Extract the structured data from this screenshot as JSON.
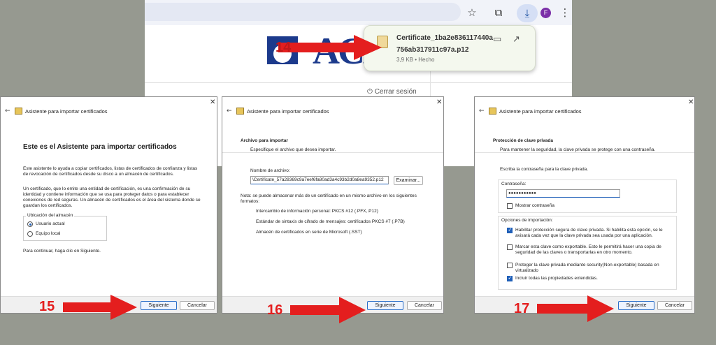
{
  "browser": {
    "icons": [
      "star-icon",
      "extensions-icon",
      "download-icon",
      "profile-avatar",
      "more-menu-icon"
    ],
    "avatar_letter": "F",
    "logout": "⏻ Cerrar sesión",
    "download": {
      "filename_line1": "Certificate_1ba2e836117440a",
      "filename_line2": "756ab317911c97a.p12",
      "meta": "3,9 KB • Hecho"
    }
  },
  "step_numbers": {
    "s14": "14",
    "s15": "15",
    "s16": "16",
    "s17": "17"
  },
  "wizard_title": "Asistente para importar certificados",
  "dialog1": {
    "heading": "Este es el Asistente para importar certificados",
    "p1": "Este asistente lo ayuda a copiar certificados, listas de certificados de confianza y listas de revocación de certificados desde su disco a un almacén de certificados.",
    "p2": "Un certificado, que lo emite una entidad de certificación, es una confirmación de su identidad y contiene información que se usa para proteger datos o para establecer conexiones de red seguras. Un almacén de certificados es el área del sistema donde se guardan los certificados.",
    "store_group": "Ubicación del almacén",
    "opt_user": "Usuario actual",
    "opt_machine": "Equipo local",
    "continue": "Para continuar, haga clic en Siguiente.",
    "next": "Siguiente",
    "cancel": "Cancelar"
  },
  "dialog2": {
    "section": "Archivo para importar",
    "sub": "Especifique el archivo que desea importar.",
    "file_label": "Nombre de archivo:",
    "file_value": "\\Certificate_57a28369c9a7eef6fa80ad3a4c93b2d0a8ea9352.p12",
    "browse": "Examinar...",
    "note": "Nota: se puede almacenar más de un certificado en un mismo archivo en los siguientes formatos:",
    "fmt1": "Intercambio de información personal: PKCS #12 (.PFX,.P12)",
    "fmt2": "Estándar de sintaxis de cifrado de mensajes: certificados PKCS #7 (.P7B)",
    "fmt3": "Almacén de certificados en serie de Microsoft (.SST)",
    "next": "Siguiente",
    "cancel": "Cancelar"
  },
  "dialog3": {
    "section": "Protección de clave privada",
    "sub": "Para mantener la seguridad, la clave privada se protege con una contraseña.",
    "instr": "Escriba la contraseña para la clave privada.",
    "pwd_label": "Contraseña:",
    "pwd_value": "●●●●●●●●●●●",
    "show_pwd": "Mostrar contraseña",
    "options_label": "Opciones de importación:",
    "opt1": "Habilitar protección segura de clave privada. Si habilita esta opción, se le avisará cada vez que la clave privada sea usada por una aplicación.",
    "opt2": "Marcar esta clave como exportable. Esto le permitirá hacer una copia de seguridad de las claves o transportarlas en otro momento.",
    "opt3": "Proteger la clave privada mediante security(Non-exportable) basada en virtualizado",
    "opt4": "Incluir todas las propiedades extendidas.",
    "next": "Siguiente",
    "cancel": "Cancelar"
  },
  "colors": {
    "arrow": "#e41e1e",
    "accent": "#1f5fb8"
  }
}
